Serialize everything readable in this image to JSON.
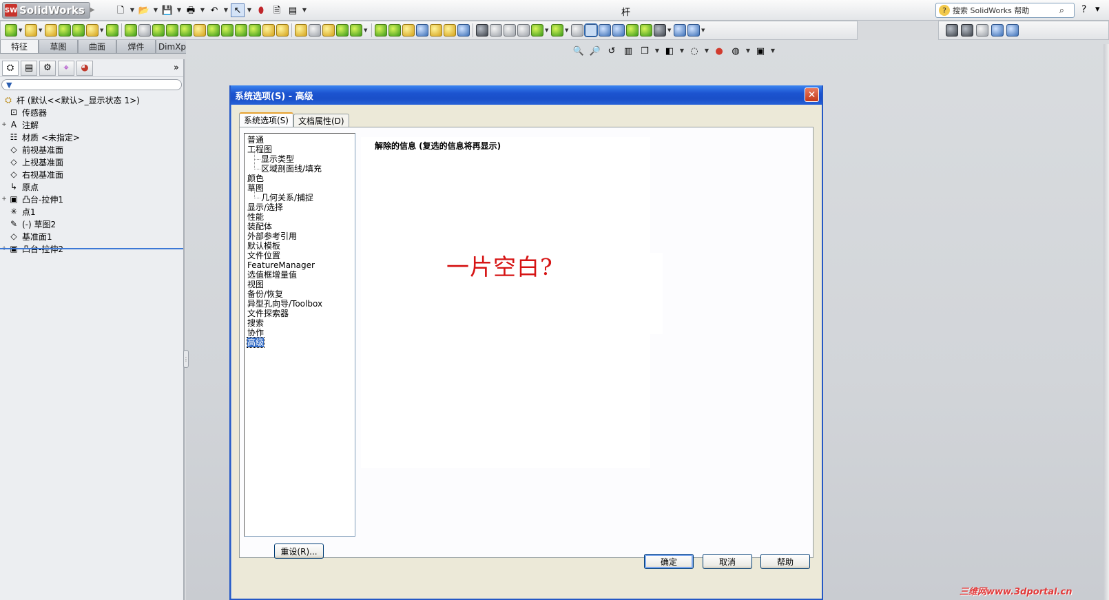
{
  "app": {
    "logo_text": "SolidWorks",
    "logo_mark": "SW",
    "document_title": "杆",
    "search_placeholder": "搜索 SolidWorks 帮助",
    "help_glyph": "?"
  },
  "command_tabs": [
    "特征",
    "草图",
    "曲面",
    "焊件",
    "DimXpert"
  ],
  "feature_tree": {
    "filter_icon": "filter-icon",
    "root_label": "杆  (默认<<默认>_显示状态 1>)",
    "items": [
      {
        "label": "传感器",
        "expand": "",
        "icon": "sensor-icon",
        "glyph": "⊡"
      },
      {
        "label": "注解",
        "expand": "+",
        "icon": "annotation-icon",
        "glyph": "A"
      },
      {
        "label": "材质 <未指定>",
        "expand": "",
        "icon": "material-icon",
        "glyph": "☷"
      },
      {
        "label": "前视基准面",
        "expand": "",
        "icon": "plane-icon",
        "glyph": "◇"
      },
      {
        "label": "上视基准面",
        "expand": "",
        "icon": "plane-icon",
        "glyph": "◇"
      },
      {
        "label": "右视基准面",
        "expand": "",
        "icon": "plane-icon",
        "glyph": "◇"
      },
      {
        "label": "原点",
        "expand": "",
        "icon": "origin-icon",
        "glyph": "↳"
      },
      {
        "label": "凸台-拉伸1",
        "expand": "+",
        "icon": "extrude-icon",
        "glyph": "▣"
      },
      {
        "label": "点1",
        "expand": "",
        "icon": "point-icon",
        "glyph": "✳"
      },
      {
        "label": "(-) 草图2",
        "expand": "",
        "icon": "sketch-icon",
        "glyph": "✎"
      },
      {
        "label": "基准面1",
        "expand": "",
        "icon": "plane-icon",
        "glyph": "◇"
      },
      {
        "label": "凸台-拉伸2",
        "expand": "+",
        "icon": "extrude-icon",
        "glyph": "▣"
      }
    ]
  },
  "dialog": {
    "title": "系统选项(S) - 高级",
    "tabs": [
      "系统选项(S)",
      "文档属性(D)"
    ],
    "categories": [
      {
        "label": "普通",
        "sub": false
      },
      {
        "label": "工程图",
        "sub": false
      },
      {
        "label": "显示类型",
        "sub": true
      },
      {
        "label": "区域剖面线/填充",
        "sub": true
      },
      {
        "label": "颜色",
        "sub": false
      },
      {
        "label": "草图",
        "sub": false
      },
      {
        "label": "几何关系/捕捉",
        "sub": true
      },
      {
        "label": "显示/选择",
        "sub": false
      },
      {
        "label": "性能",
        "sub": false
      },
      {
        "label": "装配体",
        "sub": false
      },
      {
        "label": "外部参考引用",
        "sub": false
      },
      {
        "label": "默认模板",
        "sub": false
      },
      {
        "label": "文件位置",
        "sub": false
      },
      {
        "label": "FeatureManager",
        "sub": false
      },
      {
        "label": "选值框增量值",
        "sub": false
      },
      {
        "label": "视图",
        "sub": false
      },
      {
        "label": "备份/恢复",
        "sub": false
      },
      {
        "label": "异型孔向导/Toolbox",
        "sub": false
      },
      {
        "label": "文件探索器",
        "sub": false
      },
      {
        "label": "搜索",
        "sub": false
      },
      {
        "label": "协作",
        "sub": false
      },
      {
        "label": "高级",
        "sub": false,
        "selected": true
      }
    ],
    "content_heading": "解除的信息 (复选的信息将再显示)",
    "annotation_text": "一片空白?",
    "reset_label": "重设(R)...",
    "ok_label": "确定",
    "cancel_label": "取消",
    "help_label": "帮助"
  },
  "watermark": "三维网www.3dportal.cn",
  "colors": {
    "dialog_title_bar": "#1c54d0",
    "selection": "#316ac5",
    "annotation": "#d61414"
  }
}
